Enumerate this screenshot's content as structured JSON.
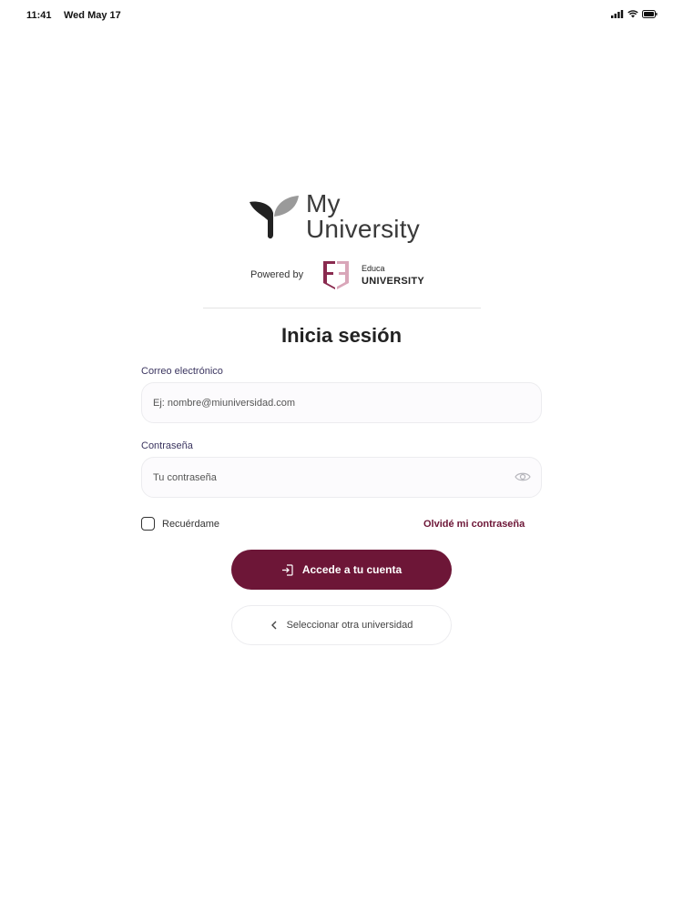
{
  "status_bar": {
    "time": "11:41",
    "date": "Wed May 17",
    "icons": [
      "signal-icon",
      "wifi-icon",
      "battery-icon"
    ]
  },
  "brand": {
    "logo_line1": "My",
    "logo_line2": "University",
    "powered_by": "Powered by",
    "partner_small": "Educa",
    "partner_big": "UNIVERSITY",
    "accent_color": "#6d1637"
  },
  "login": {
    "title": "Inicia sesión",
    "email_label": "Correo electrónico",
    "email_placeholder": "Ej: nombre@miuniversidad.com",
    "email_value": "",
    "password_label": "Contraseña",
    "password_placeholder": "Tu contraseña",
    "password_value": "",
    "remember_label": "Recuérdame",
    "remember_checked": false,
    "forgot_label": "Olvidé mi contraseña",
    "submit_label": "Accede a tu cuenta",
    "back_label": "Seleccionar otra universidad"
  }
}
